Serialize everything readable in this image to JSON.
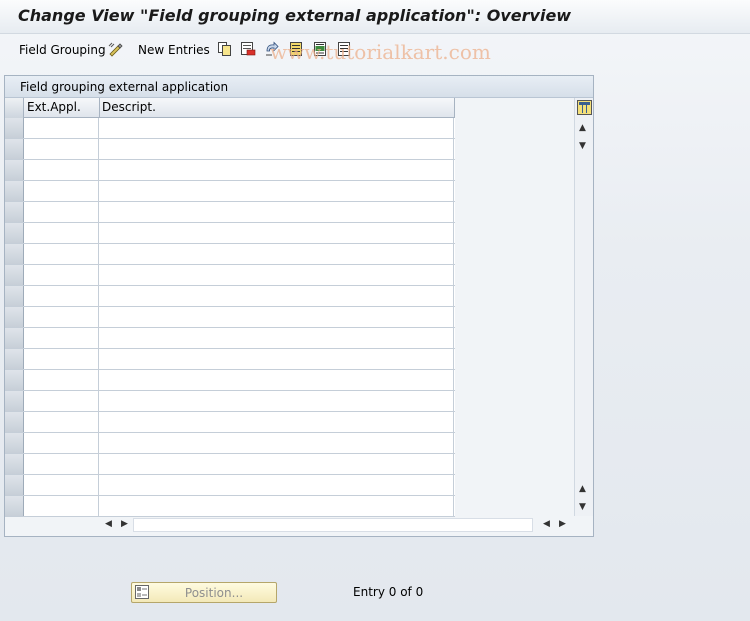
{
  "window": {
    "title": "Change View \"Field grouping external application\": Overview"
  },
  "toolbar": {
    "field_grouping_label": "Field Grouping",
    "new_entries_label": "New Entries",
    "icons": [
      "edit-glasses-icon",
      "copy-icon",
      "delete-icon",
      "undo-icon",
      "select-all-icon",
      "select-block-icon",
      "deselect-all-icon"
    ]
  },
  "watermark": "www.tutorialkart.com",
  "table": {
    "title": "Field grouping external application",
    "columns": [
      "Ext.Appl.",
      "Descript."
    ],
    "row_count": 19
  },
  "footer": {
    "position_button_label": "Position...",
    "entry_info": "Entry 0 of 0"
  },
  "colors": {
    "row_selector": "#c7cfd8",
    "grid_line": "#c5ced8",
    "button_bg": "#f3e9b8"
  }
}
